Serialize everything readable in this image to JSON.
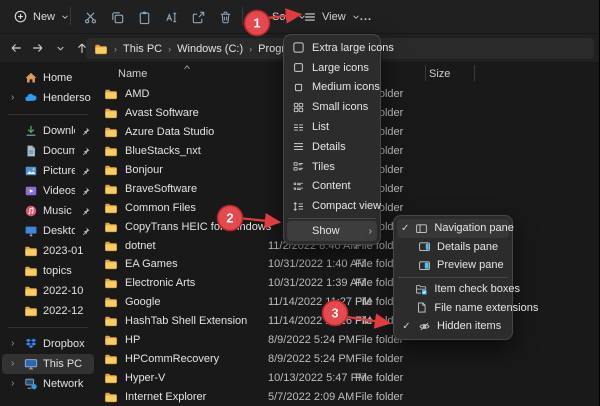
{
  "toolbar": {
    "new_label": "New",
    "sort_label": "Sort",
    "view_label": "View",
    "more_label": "...",
    "tools": [
      "cut",
      "copy",
      "paste",
      "rename",
      "share",
      "delete"
    ]
  },
  "addressbar": {
    "nav_icons": [
      "back",
      "forward",
      "recent-dropdown",
      "up"
    ],
    "crumb_root_icon": "folder",
    "crumbs": [
      "This PC",
      "Windows (C:)",
      "Program Files"
    ]
  },
  "sidebar": {
    "top": [
      {
        "id": "home",
        "label": "Home",
        "icon": "home",
        "expandable": false
      },
      {
        "id": "onedrive",
        "label": "Henderson - Personal",
        "icon": "onedrive",
        "expandable": true
      }
    ],
    "pinned": [
      {
        "id": "downloads",
        "label": "Downloads",
        "icon": "downloads",
        "pinned": true
      },
      {
        "id": "documents",
        "label": "Documents",
        "icon": "documents",
        "pinned": true
      },
      {
        "id": "pictures",
        "label": "Pictures",
        "icon": "pictures",
        "pinned": true
      },
      {
        "id": "videos",
        "label": "Videos",
        "icon": "videos",
        "pinned": true
      },
      {
        "id": "music",
        "label": "Music",
        "icon": "music",
        "pinned": true
      },
      {
        "id": "desktop",
        "label": "Desktop",
        "icon": "desktop",
        "pinned": true
      }
    ],
    "folders": [
      {
        "id": "2023-01",
        "label": "2023-01",
        "icon": "folder"
      },
      {
        "id": "topics",
        "label": "topics",
        "icon": "folder"
      },
      {
        "id": "2022-10",
        "label": "2022-10",
        "icon": "folder"
      },
      {
        "id": "2022-12",
        "label": "2022-12",
        "icon": "folder"
      }
    ],
    "bottom": [
      {
        "id": "dropbox",
        "label": "Dropbox",
        "icon": "dropbox",
        "expandable": true
      },
      {
        "id": "this-pc",
        "label": "This PC",
        "icon": "thispc",
        "expandable": true,
        "selected": true
      },
      {
        "id": "network",
        "label": "Network",
        "icon": "network",
        "expandable": true
      }
    ]
  },
  "files": {
    "name_header": "Name",
    "size_header": "Size",
    "rows": [
      {
        "name": "AMD",
        "date": "",
        "type": "File folder"
      },
      {
        "name": "Avast Software",
        "date": "",
        "type": "File folder"
      },
      {
        "name": "Azure Data Studio",
        "date": "",
        "type": "File folder"
      },
      {
        "name": "BlueStacks_nxt",
        "date": "",
        "type": "File folder"
      },
      {
        "name": "Bonjour",
        "date": "",
        "type": "File folder"
      },
      {
        "name": "BraveSoftware",
        "date": "",
        "type": "File folder"
      },
      {
        "name": "Common Files",
        "date": "",
        "type": "File folder"
      },
      {
        "name": "CopyTrans HEIC for Windows",
        "date": "",
        "type": "File folder"
      },
      {
        "name": "dotnet",
        "date": "11/2/2022 8:40 AM",
        "type": "File folder"
      },
      {
        "name": "EA Games",
        "date": "10/31/2022 1:40 AM",
        "type": "File folder"
      },
      {
        "name": "Electronic Arts",
        "date": "10/31/2022 1:39 AM",
        "type": "File folder"
      },
      {
        "name": "Google",
        "date": "11/14/2022 11:27 PM",
        "type": "File folder"
      },
      {
        "name": "HashTab Shell Extension",
        "date": "11/14/2022 11:26 PM",
        "type": "File folder"
      },
      {
        "name": "HP",
        "date": "8/9/2022 5:24 PM",
        "type": "File folder"
      },
      {
        "name": "HPCommRecovery",
        "date": "8/9/2022 5:24 PM",
        "type": "File folder"
      },
      {
        "name": "Hyper-V",
        "date": "10/13/2022 5:47 PM",
        "type": "File folder"
      },
      {
        "name": "Internet Explorer",
        "date": "5/7/2022 2:09 AM",
        "type": "File folder"
      }
    ]
  },
  "view_menu": {
    "items": [
      {
        "id": "extra-large-icons",
        "label": "Extra large icons",
        "icon": "xl"
      },
      {
        "id": "large-icons",
        "label": "Large icons",
        "icon": "lg"
      },
      {
        "id": "medium-icons",
        "label": "Medium icons",
        "icon": "md"
      },
      {
        "id": "small-icons",
        "label": "Small icons",
        "icon": "sm"
      },
      {
        "id": "list",
        "label": "List",
        "icon": "list"
      },
      {
        "id": "details",
        "label": "Details",
        "icon": "details"
      },
      {
        "id": "tiles",
        "label": "Tiles",
        "icon": "tiles"
      },
      {
        "id": "content",
        "label": "Content",
        "icon": "content"
      },
      {
        "id": "compact-view",
        "label": "Compact view",
        "icon": "compact"
      }
    ],
    "show_label": "Show"
  },
  "show_submenu": {
    "panes": [
      {
        "id": "navigation-pane",
        "label": "Navigation pane",
        "icon": "navpane",
        "checked": true,
        "highlight": true
      },
      {
        "id": "details-pane",
        "label": "Details pane",
        "icon": "detailspane",
        "checked": false
      },
      {
        "id": "preview-pane",
        "label": "Preview pane",
        "icon": "previewpane",
        "checked": false
      }
    ],
    "options": [
      {
        "id": "item-check-boxes",
        "label": "Item check boxes",
        "icon": "checkboxes",
        "checked": false
      },
      {
        "id": "file-name-extensions",
        "label": "File name extensions",
        "icon": "extensions",
        "checked": false
      },
      {
        "id": "hidden-items",
        "label": "Hidden items",
        "icon": "hidden",
        "checked": true
      }
    ]
  },
  "annotations": {
    "color": "#e23b3f",
    "step1": "1",
    "step2": "2",
    "step3": "3"
  }
}
